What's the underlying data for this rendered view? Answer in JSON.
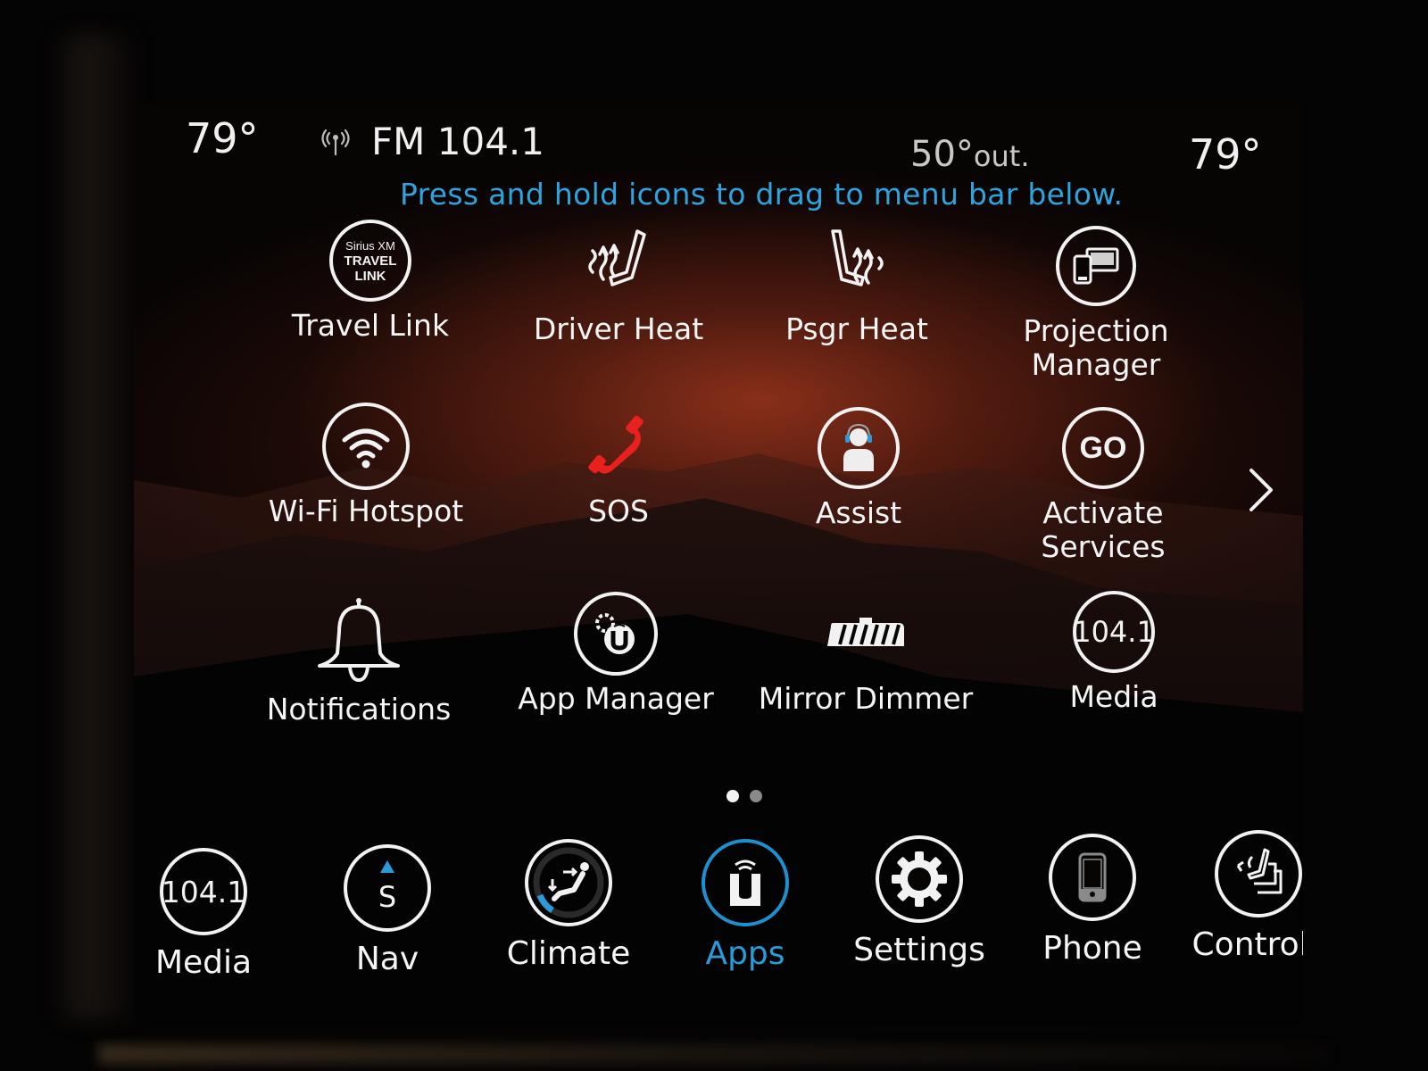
{
  "status_bar": {
    "driver_temp": "79°",
    "source_icon": "radio-antenna-icon",
    "source_label": "FM 104.1",
    "outside_temp": "50°",
    "outside_suffix": "out.",
    "passenger_temp": "79°"
  },
  "hint_text": "Press and hold icons to drag to menu bar below.",
  "apps": [
    {
      "label": "Travel Link",
      "icon": "siriusxm-travel-link-icon",
      "icon_text": [
        "Sirius XM",
        "TRAVEL",
        "LINK"
      ]
    },
    {
      "label": "Driver Heat",
      "icon": "driver-seat-heat-icon"
    },
    {
      "label": "Psgr Heat",
      "icon": "passenger-seat-heat-icon"
    },
    {
      "label": "Projection Manager",
      "label_lines": [
        "Projection",
        "Manager"
      ],
      "icon": "projection-devices-icon"
    },
    {
      "label": "Wi-Fi Hotspot",
      "icon": "wifi-icon"
    },
    {
      "label": "SOS",
      "icon": "phone-handset-icon"
    },
    {
      "label": "Assist",
      "icon": "headset-agent-icon"
    },
    {
      "label": "Activate Services",
      "icon": "go-icon",
      "icon_text": "GO"
    },
    {
      "label": "Notifications",
      "icon": "bell-icon"
    },
    {
      "label": "App Manager",
      "icon": "uconnect-gear-icon"
    },
    {
      "label": "Mirror Dimmer",
      "icon": "rearview-mirror-icon"
    },
    {
      "label": "Media",
      "icon": "radio-frequency-icon",
      "icon_text": "104.1"
    }
  ],
  "next_page_icon": "chevron-right-icon",
  "pager": {
    "current_page": 1,
    "total_pages": 2
  },
  "bottom_bar": {
    "active_tab": "Apps",
    "tabs": [
      {
        "label": "Media",
        "icon": "radio-frequency-icon",
        "icon_text": "104.1"
      },
      {
        "label": "Nav",
        "icon": "compass-icon",
        "icon_text": "S"
      },
      {
        "label": "Climate",
        "icon": "climate-airflow-icon"
      },
      {
        "label": "Apps",
        "icon": "uconnect-icon"
      },
      {
        "label": "Settings",
        "icon": "gear-icon"
      },
      {
        "label": "Phone",
        "icon": "smartphone-icon"
      },
      {
        "label": "Controls",
        "icon": "seat-controls-icon"
      }
    ]
  },
  "colors": {
    "accent_blue": "#2a9ad8",
    "sos_red": "#e8201e",
    "text_white": "#f2f2f2",
    "outside_temp_grey": "#c8c8c8",
    "wallpaper_glow": "#96341c"
  }
}
